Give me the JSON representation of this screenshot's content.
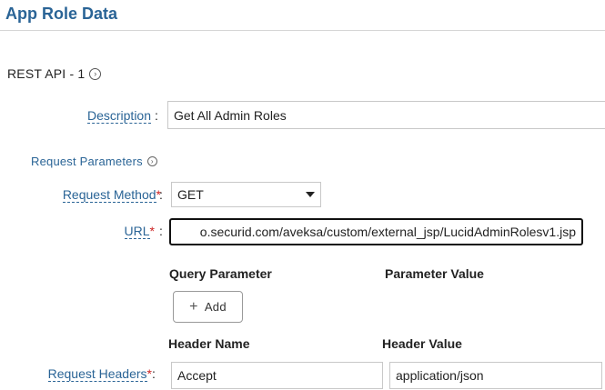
{
  "page": {
    "title": "App Role Data"
  },
  "section": {
    "title": "REST API - 1",
    "icon": "chevron-right-circle-icon"
  },
  "fields": {
    "description": {
      "label": "Description",
      "colon": ":",
      "value": "Get All Admin Roles"
    },
    "request_method": {
      "label": "Request Method",
      "required": "*",
      "colon": ":",
      "value": "GET"
    },
    "url": {
      "label": "URL",
      "required": "*",
      "colon": ":",
      "value": "o.securid.com/aveksa/custom/external_jsp/LucidAdminRolesv1.jsp"
    },
    "request_headers": {
      "label": "Request Headers",
      "required": "*",
      "colon": ":"
    }
  },
  "request_parameters": {
    "title": "Request Parameters",
    "icon": "chevron-right-circle-icon"
  },
  "query_table": {
    "col_param": "Query Parameter",
    "col_value": "Parameter Value",
    "add_label": "Add",
    "add_icon": "plus-icon"
  },
  "headers_table": {
    "col_name": "Header Name",
    "col_value": "Header Value",
    "rows": [
      {
        "name": "Accept",
        "value": "application/json"
      }
    ]
  },
  "colors": {
    "accent": "#2a6496",
    "required": "#cc2222"
  }
}
